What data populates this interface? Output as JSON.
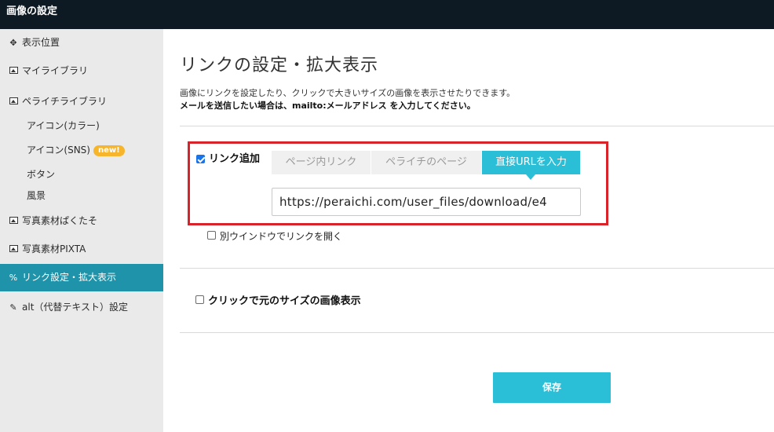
{
  "header": {
    "title": "画像の設定"
  },
  "sidebar": {
    "items": [
      {
        "icon": "move-icon",
        "label": "表示位置"
      },
      {
        "icon": "image-icon",
        "label": "マイライブラリ"
      },
      {
        "icon": "image-icon",
        "label": "ペライチライブラリ"
      },
      {
        "icon": "image-icon",
        "label": "写真素材ぱくたそ"
      },
      {
        "icon": "image-icon",
        "label": "写真素材PIXTA"
      },
      {
        "icon": "link-icon",
        "label": "リンク設定・拡大表示",
        "active": true
      },
      {
        "icon": "pencil-icon",
        "label": "alt（代替テキスト）設定"
      }
    ],
    "subitems": [
      {
        "label": "アイコン(カラー)"
      },
      {
        "label": "アイコン(SNS)",
        "badge": "new!"
      },
      {
        "label": "ボタン"
      },
      {
        "label": "風景"
      }
    ],
    "active_color": "#1f93a9",
    "badge_color": "#f7b52b"
  },
  "main": {
    "title": "リンクの設定・拡大表示",
    "description_1": "画像にリンクを設定したり、クリックで大きいサイズの画像を表示させたりできます。",
    "description_2": "メールを送信したい場合は、mailto:メールアドレス を入力してください。",
    "link_add": {
      "checked": true,
      "label": "リンク追加",
      "tabs": [
        {
          "label": "ページ内リンク",
          "active": false
        },
        {
          "label": "ペライチのページ",
          "active": false
        },
        {
          "label": "直接URLを入力",
          "active": true
        }
      ],
      "url_value": "https://peraichi.com/user_files/download/e4",
      "open_new_window": {
        "checked": false,
        "label": "別ウインドウでリンクを開く"
      }
    },
    "original_size": {
      "checked": false,
      "label": "クリックで元のサイズの画像表示"
    },
    "save_label": "保存",
    "accent_color": "#2bbfd7",
    "highlight_color": "#d8232a"
  }
}
